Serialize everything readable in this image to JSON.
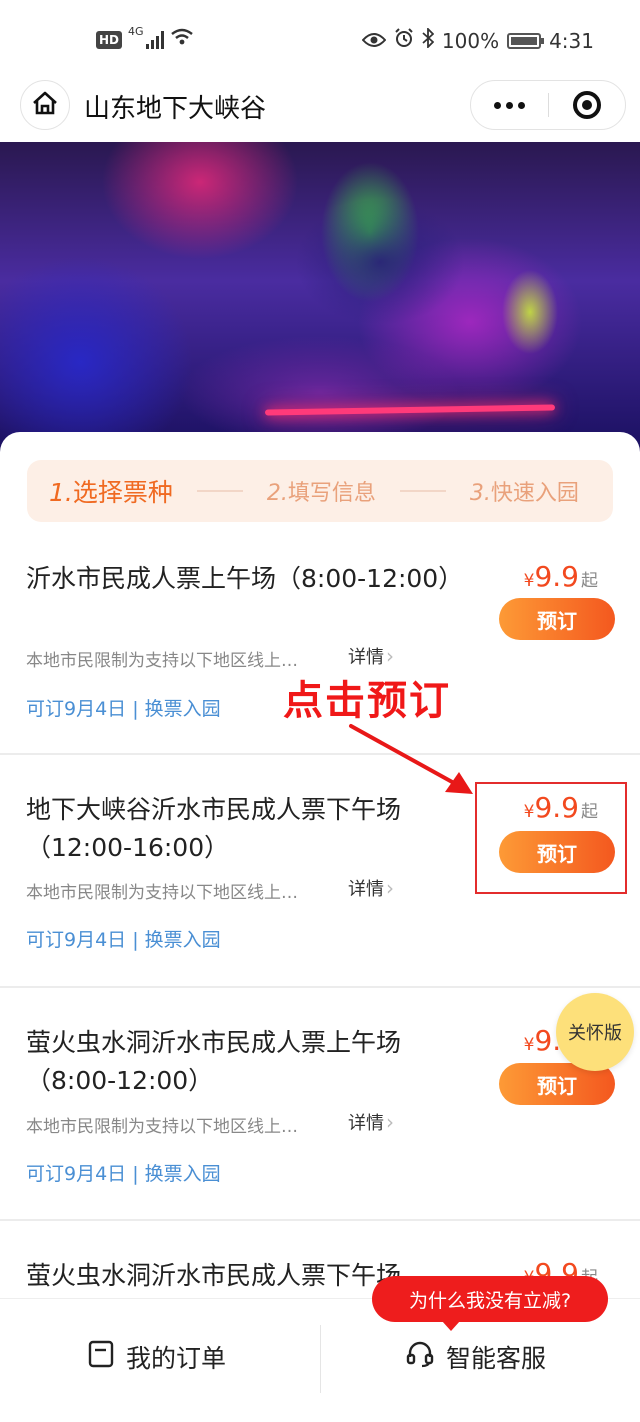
{
  "status_bar": {
    "hd": "HD",
    "network": "4G",
    "battery": "100%",
    "time": "4:31"
  },
  "nav": {
    "title": "山东地下大峡谷"
  },
  "steps": [
    {
      "num": "1.",
      "label": "选择票种"
    },
    {
      "num": "2.",
      "label": "填写信息"
    },
    {
      "num": "3.",
      "label": "快速入园"
    }
  ],
  "tickets": [
    {
      "name": "沂水市民成人票上午场（8:00-12:00）",
      "desc": "本地市民限制为支持以下地区线上…",
      "detail": "详情",
      "tags": "可订9月4日 | 换票入园",
      "currency": "¥",
      "price": "9.9",
      "suffix": "起",
      "book_label": "预订"
    },
    {
      "name": "地下大峡谷沂水市民成人票下午场（12:00-16:00）",
      "desc": "本地市民限制为支持以下地区线上…",
      "detail": "详情",
      "tags": "可订9月4日 | 换票入园",
      "currency": "¥",
      "price": "9.9",
      "suffix": "起",
      "book_label": "预订"
    },
    {
      "name": "萤火虫水洞沂水市民成人票上午场（8:00-12:00）",
      "desc": "本地市民限制为支持以下地区线上…",
      "detail": "详情",
      "tags": "可订9月4日 | 换票入园",
      "currency": "¥",
      "price": "9.9",
      "suffix": "起",
      "book_label": "预订"
    },
    {
      "name": "萤火虫水洞沂水市民成人票下午场",
      "currency": "¥",
      "price": "9.9",
      "suffix": "起"
    }
  ],
  "annotation": {
    "text": "点击预订"
  },
  "care_badge": "关怀版",
  "tooltip": "为什么我没有立减?",
  "bottom_bar": {
    "orders_label": "我的订单",
    "service_label": "智能客服"
  },
  "colors": {
    "accent_orange": "#f4581f",
    "price_red": "#f2491f",
    "tag_blue": "#4a8fd4",
    "annotation_red": "#f01818",
    "tooltip_red": "#ee1d1d",
    "care_yellow": "#fde07a"
  },
  "icons": {
    "home": "home-icon",
    "more": "more-dots-icon",
    "close": "target-close-icon",
    "orders": "order-list-icon",
    "service": "headset-icon"
  }
}
